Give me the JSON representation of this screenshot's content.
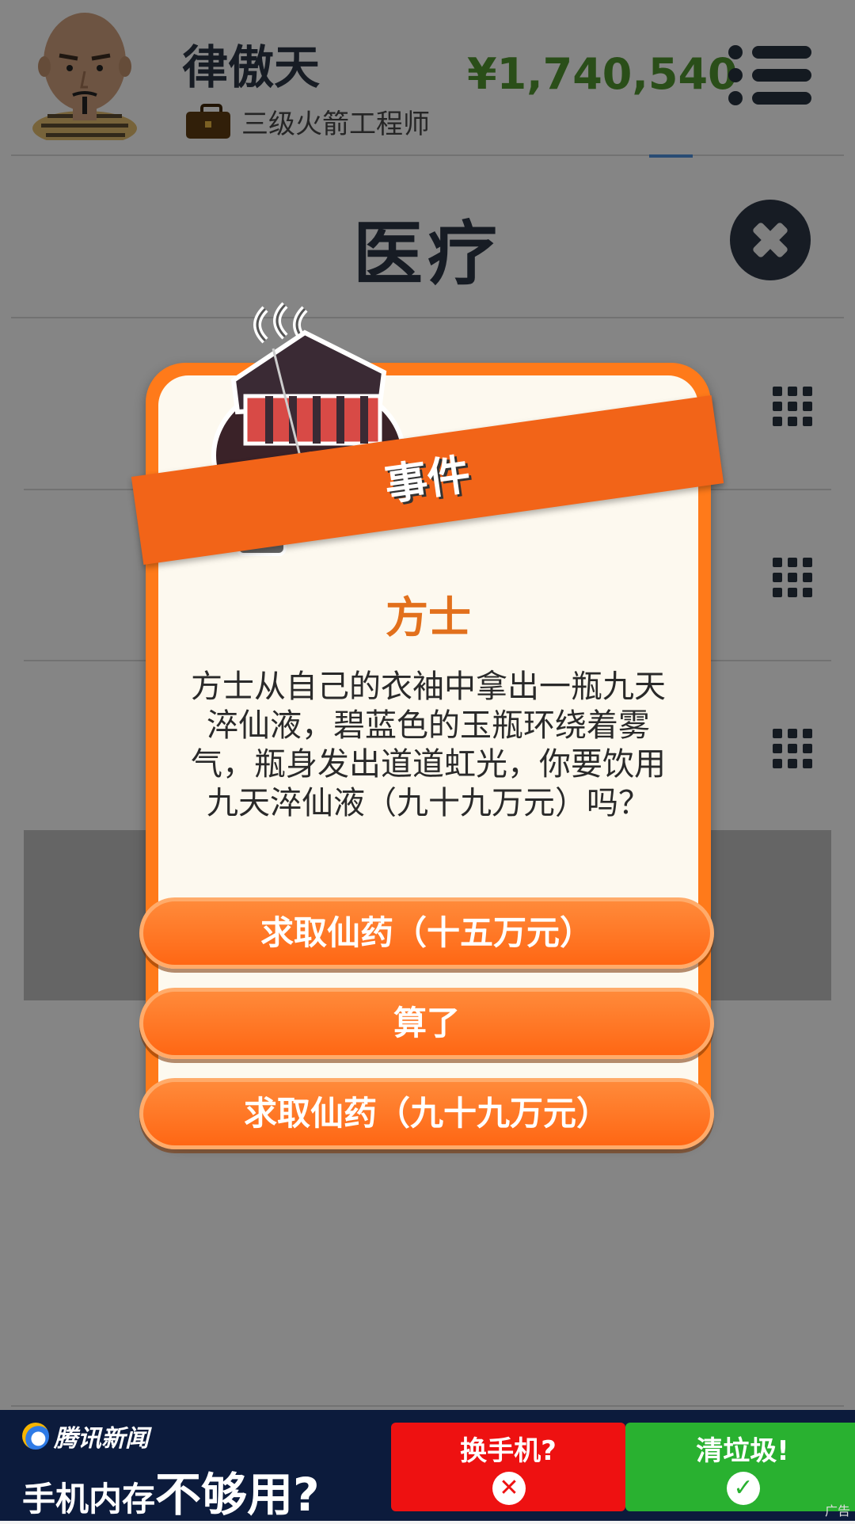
{
  "header": {
    "player_name": "律傲天",
    "job_title": "三级火箭工程师",
    "money": "¥1,740,540"
  },
  "screen": {
    "title": "医疗"
  },
  "event_dialog": {
    "banner_label": "事件",
    "title": "方士",
    "description": "方士从自己的衣袖中拿出一瓶九天淬仙液，碧蓝色的玉瓶环绕着雾气，瓶身发出道道虹光，你要饮用九天淬仙液（九十九万元）吗？",
    "choices": [
      "求取仙药（十五万元）",
      "算了",
      "求取仙药（九十九万元）"
    ]
  },
  "ad": {
    "brand": "腾讯新闻",
    "headline_small": "手机内存",
    "headline_big": "不够用?",
    "button_red_label": "换手机?",
    "button_green_label": "清垃圾!",
    "tag": "广告"
  },
  "colors": {
    "accent_orange": "#ff6714",
    "money_green": "#4e8f2e",
    "dark_navy": "#2a3342",
    "ad_red": "#ee1111",
    "ad_green": "#29b130"
  }
}
